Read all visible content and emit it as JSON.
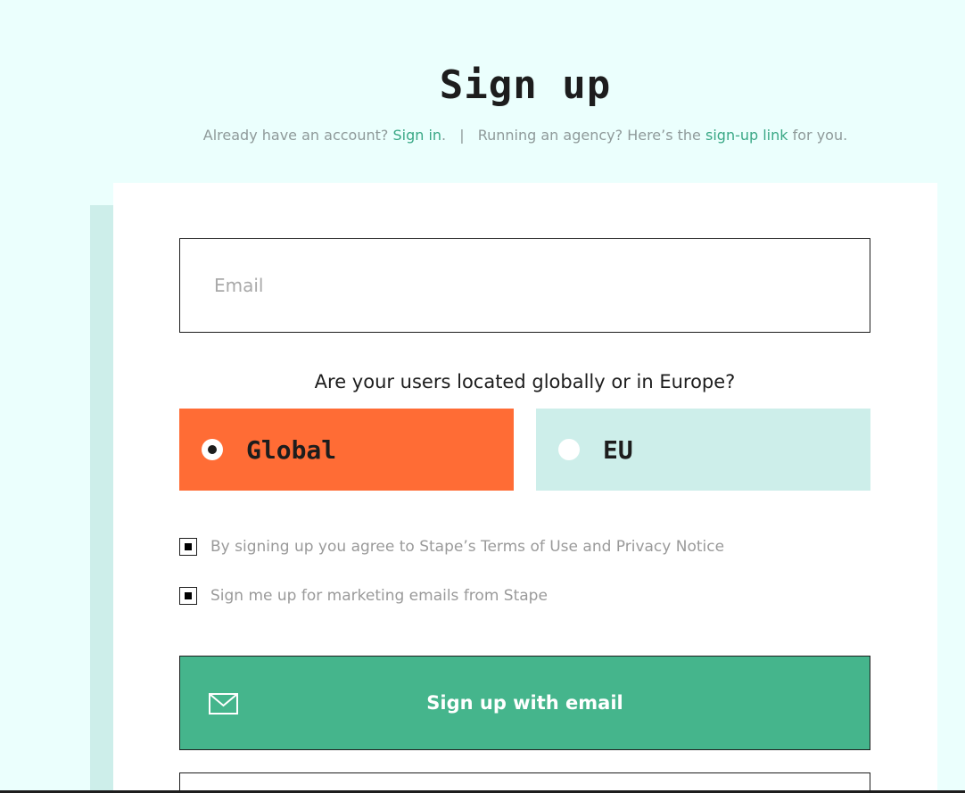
{
  "header": {
    "title": "Sign up",
    "subtitle_prefix": "Already have an account?",
    "signin_link": "Sign in",
    "signin_suffix": ".",
    "separator": "|",
    "agency_prefix": "Running an agency? Here’s the",
    "agency_link": "sign-up link",
    "agency_suffix": "for you."
  },
  "form": {
    "email_placeholder": "Email",
    "email_value": "",
    "region_question": "Are your users located globally or in Europe?",
    "regions": [
      {
        "label": "Global",
        "selected": true
      },
      {
        "label": "EU",
        "selected": false
      }
    ],
    "checkboxes": [
      {
        "label": "By signing up you agree to Stape’s Terms of Use and Privacy Notice",
        "checked": true
      },
      {
        "label": "Sign me up for marketing emails from Stape",
        "checked": true
      }
    ],
    "signup_email_label": "Sign up with email"
  },
  "colors": {
    "background": "#ebfffd",
    "accent_green": "#45b58c",
    "link_green": "#3aa886",
    "global_orange": "#ff6c35",
    "eu_mint": "#cdeeea"
  },
  "icons": {
    "signup_email": "envelope-icon"
  }
}
